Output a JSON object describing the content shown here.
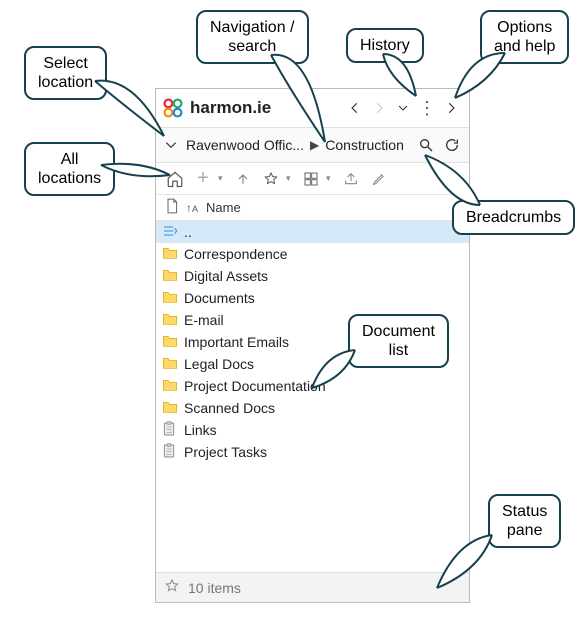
{
  "brand": "harmon.ie",
  "breadcrumb": {
    "loc1": "Ravenwood Offic...",
    "loc2": "Construction"
  },
  "columns": {
    "name": "Name"
  },
  "rows": [
    {
      "type": "up",
      "label": ".."
    },
    {
      "type": "folder",
      "label": "Correspondence"
    },
    {
      "type": "folder",
      "label": "Digital Assets"
    },
    {
      "type": "folder",
      "label": "Documents"
    },
    {
      "type": "folder",
      "label": "E-mail"
    },
    {
      "type": "folder",
      "label": "Important Emails"
    },
    {
      "type": "folder",
      "label": "Legal Docs"
    },
    {
      "type": "folder",
      "label": "Project Documentation"
    },
    {
      "type": "folder",
      "label": "Scanned Docs"
    },
    {
      "type": "list",
      "label": "Links"
    },
    {
      "type": "list",
      "label": "Project Tasks"
    }
  ],
  "status": {
    "text": "10 items"
  },
  "callouts": {
    "select_location": "Select\nlocation",
    "nav_search": "Navigation /\nsearch",
    "history": "History",
    "options": "Options\nand help",
    "all_locations": "All\nlocations",
    "breadcrumbs": "Breadcrumbs",
    "doc_list": "Document\nlist",
    "status_pane": "Status\npane"
  }
}
